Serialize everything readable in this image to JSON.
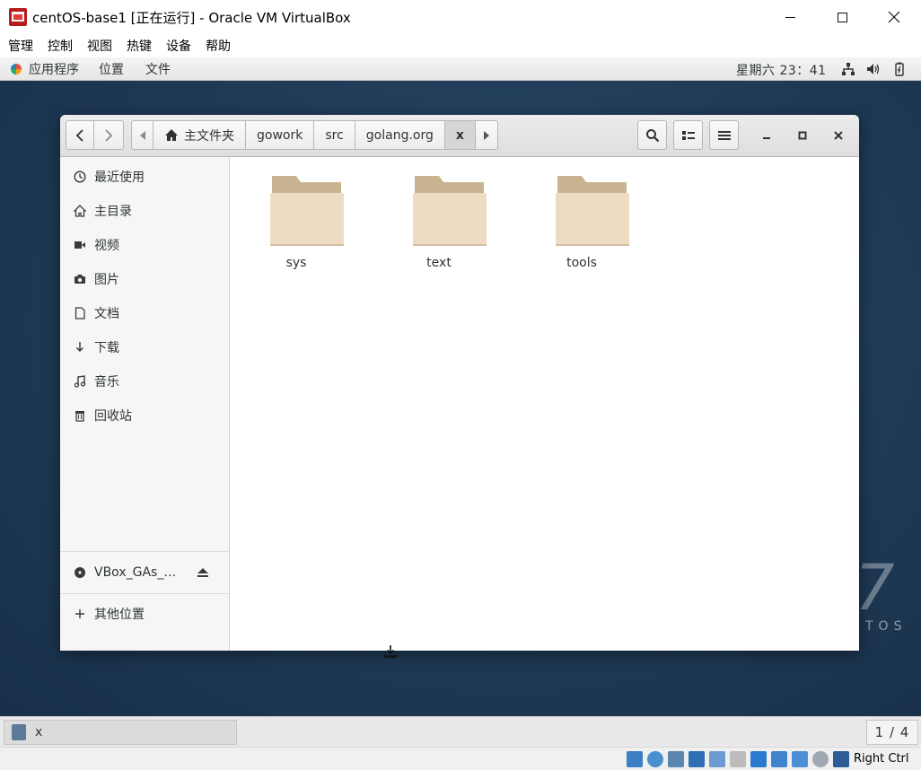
{
  "host_window": {
    "title": "centOS-base1 [正在运行] - Oracle VM VirtualBox",
    "menu": [
      "管理",
      "控制",
      "视图",
      "热键",
      "设备",
      "帮助"
    ]
  },
  "gnome_topbar": {
    "applications": "应用程序",
    "places": "位置",
    "files": "文件",
    "clock": "星期六 23：41",
    "tray_icons": [
      "network-icon",
      "volume-icon",
      "battery-icon"
    ]
  },
  "desktop": {
    "brand_mark": "7",
    "brand_text": "TOS"
  },
  "file_manager": {
    "path": [
      "主文件夹",
      "gowork",
      "src",
      "golang.org",
      "x"
    ],
    "sidebar": {
      "items": [
        {
          "label": "最近使用",
          "icon": "recent-icon"
        },
        {
          "label": "主目录",
          "icon": "home-icon"
        },
        {
          "label": "视频",
          "icon": "video-icon"
        },
        {
          "label": "图片",
          "icon": "camera-icon"
        },
        {
          "label": "文档",
          "icon": "document-icon"
        },
        {
          "label": "下载",
          "icon": "download-icon"
        },
        {
          "label": "音乐",
          "icon": "music-icon"
        },
        {
          "label": "回收站",
          "icon": "trash-icon"
        }
      ],
      "device": {
        "label": "VBox_GAs_…",
        "icon": "disc-icon"
      },
      "other": {
        "label": "其他位置",
        "icon": "plus-icon"
      }
    },
    "folders": [
      {
        "name": "sys"
      },
      {
        "name": "text"
      },
      {
        "name": "tools"
      }
    ]
  },
  "guest_taskbar": {
    "task_label": "x",
    "workspace": "1 / 4"
  },
  "vbox_status": {
    "host_key": "Right Ctrl"
  },
  "colors": {
    "folder_front": "#eddcc3",
    "folder_back": "#c9b491",
    "desktop_bg": "#1f3a55"
  }
}
